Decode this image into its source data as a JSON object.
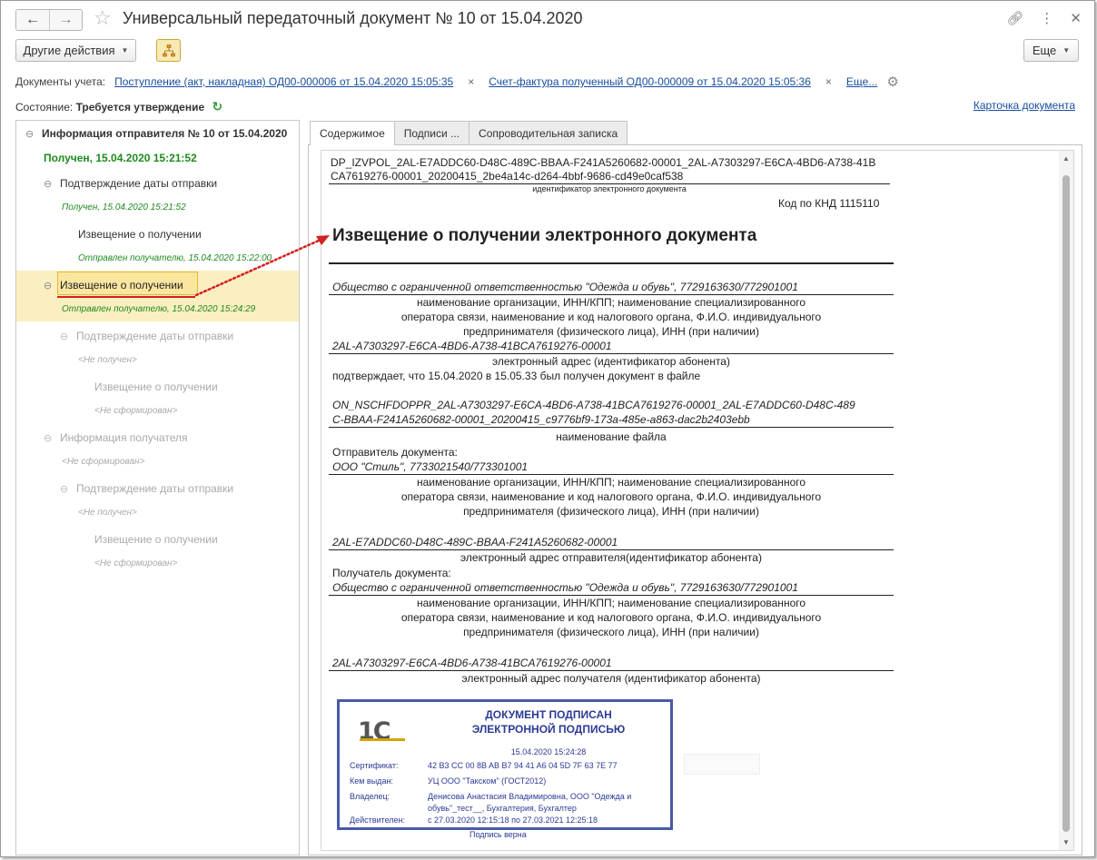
{
  "window": {
    "title": "Универсальный передаточный документ № 10 от 15.04.2020"
  },
  "toolbar": {
    "other_actions": "Другие действия",
    "more": "Еще"
  },
  "accounting_docs": {
    "label": "Документы учета:",
    "doc1": "Поступление (акт, накладная) ОД00-000006 от 15.04.2020 15:05:35",
    "doc2": "Счет-фактура полученный ОД00-000009 от 15.04.2020 15:05:36",
    "more": "Еще..."
  },
  "state": {
    "label": "Состояние:",
    "value": "Требуется утверждение"
  },
  "card_link": "Карточка документа",
  "tree": {
    "root_title": "Информация отправителя № 10 от 15.04.2020",
    "root_status": "Получен, 15.04.2020 15:21:52",
    "n1_title": "Подтверждение даты отправки",
    "n1_status": "Получен, 15.04.2020 15:21:52",
    "n2_title": "Извещение о получении",
    "n2_status": "Отправлен получателю, 15.04.2020 15:22:00",
    "n3_title": "Извещение о получении",
    "n3_status": "Отправлен получателю, 15.04.2020 15:24:29",
    "n4_title": "Подтверждение даты отправки",
    "n4_status": "<Не получен>",
    "n5_title": "Извещение о получении",
    "n5_status": "<Не сформирован>",
    "n6_title": "Информация получателя",
    "n6_status": "<Не сформирован>",
    "n7_title": "Подтверждение даты отправки",
    "n7_status": "<Не получен>",
    "n8_title": "Извещение о получении",
    "n8_status": "<Не сформирован>"
  },
  "tabs": [
    "Содержимое",
    "Подписи ...",
    "Сопроводительная записка"
  ],
  "document": {
    "id_line1": "DP_IZVPOL_2AL-E7ADDC60-D48C-489C-BBAA-F241A5260682-00001_2AL-A7303297-E6CA-4BD6-A738-41B",
    "id_line2": "CA7619276-00001_20200415_2be4a14c-d264-4bbf-9686-cd49e0caf538",
    "id_caption": "идентификатор электронного документа",
    "knd": "Код по КНД 1115110",
    "heading": "Извещение о получении электронного документа",
    "org1": "Общество с ограниченной ответственностью \"Одежда и обувь\", 7729163630/772901001",
    "org_caption_1": "наименование организации, ИНН/КПП; наименование специализированного",
    "org_caption_2": "оператора связи, наименование и код налогового органа, Ф.И.О. индивидуального",
    "org_caption_3": "предпринимателя (физического лица), ИНН (при наличии)",
    "addr1": "2AL-A7303297-E6CA-4BD6-A738-41BCA7619276-00001",
    "addr1_caption": "электронный адрес (идентификатор абонента)",
    "confirm_text": "подтверждает, что 15.04.2020 в 15.05.33 был получен документ в файле",
    "file_line1": "ON_NSCHFDOPPR_2AL-A7303297-E6CA-4BD6-A738-41BCA7619276-00001_2AL-E7ADDC60-D48C-489",
    "file_line2": "C-BBAA-F241A5260682-00001_20200415_c9776bf9-173a-485e-a863-dac2b2403ebb",
    "file_caption": "наименование файла",
    "sender_label": "Отправитель документа:",
    "sender_org": "ООО \"Стиль\", 7733021540/773301001",
    "sender_addr": "2AL-E7ADDC60-D48C-489C-BBAA-F241A5260682-00001",
    "sender_addr_caption": "электронный адрес отправителя(идентификатор абонента)",
    "recipient_label": "Получатель документа:",
    "recipient_org": "Общество с ограниченной ответственностью \"Одежда и обувь\", 7729163630/772901001",
    "recipient_addr": "2AL-A7303297-E6CA-4BD6-A738-41BCA7619276-00001",
    "recipient_addr_caption": "электронный адрес получателя (идентификатор абонента)"
  },
  "stamp": {
    "logo": "1С",
    "title1": "ДОКУМЕНТ ПОДПИСАН",
    "title2": "ЭЛЕКТРОННОЙ ПОДПИСЬЮ",
    "date": "15.04.2020 15:24:28",
    "cert_label": "Сертификат:",
    "cert_value": "42 B3 CC 00 8B AB B7 94 41 A6 04 5D 7F 63 7E 77",
    "issuer_label": "Кем выдан:",
    "issuer_value": "УЦ ООО \"Такском\" (ГОСТ2012)",
    "owner_label": "Владелец:",
    "owner_value1": "Денисова Анастасия Владимировна, ООО \"Одежда и",
    "owner_value2": "обувь\"_тест__, Бухгалтерия, Бухгалтер",
    "valid_label": "Действителен:",
    "valid_value": "с 27.03.2020 12:15:18 по 27.03.2021 12:25:18",
    "verdict": "Подпись верна"
  },
  "colors": {
    "link": "#1a4fa0",
    "status_green": "#1e8a1e",
    "selection": "#fbefc1",
    "arrow": "#d42020",
    "stamp": "#2b3a95"
  }
}
